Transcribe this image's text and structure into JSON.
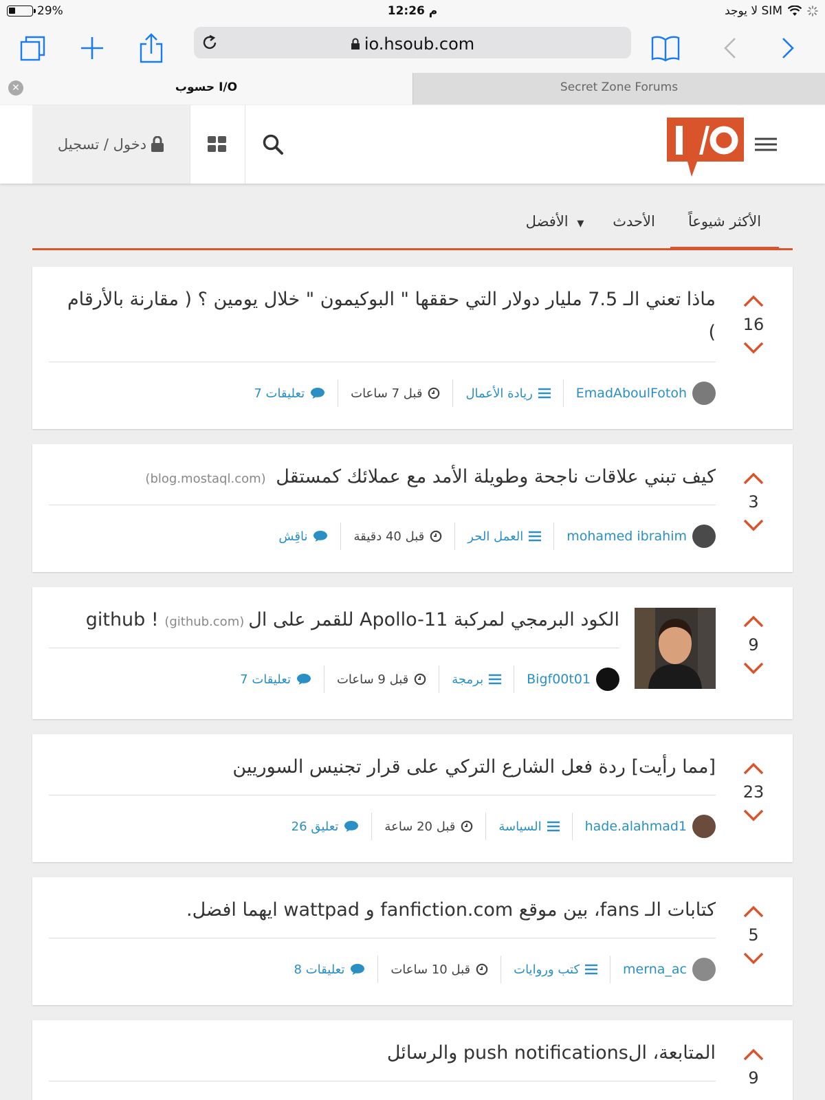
{
  "status": {
    "battery": "29%",
    "time": "12:26 م",
    "carrier": "لا يوجد SIM"
  },
  "browser": {
    "url": "io.hsoub.com"
  },
  "tabs": [
    {
      "title": "حسوب I/O",
      "active": true
    },
    {
      "title": "Secret Zone Forums",
      "active": false
    }
  ],
  "header": {
    "login_label": "دخول / تسجيل",
    "accent": "#d9532b"
  },
  "sort": {
    "popular": "الأكثر شيوعاً",
    "newest": "الأحدث",
    "best": "الأفضل"
  },
  "posts": [
    {
      "votes": "16",
      "title": "ماذا تعني الـ 7.5 مليار دولار التي حققها \" البوكيمون \" خلال يومين ؟ ( مقارنة بالأرقام )",
      "domain": "",
      "author": "EmadAboulFotoh",
      "category": "ريادة الأعمال",
      "time": "قبل 7 ساعات",
      "comments": "7 تعليقات"
    },
    {
      "votes": "3",
      "title": "كيف تبني علاقات ناجحة وطويلة الأمد مع عملائك كمستقل",
      "domain": "(blog.mostaql.com)",
      "author": "mohamed ibrahim",
      "category": "العمل الحر",
      "time": "قبل 40 دقيقة",
      "comments": "ناقِش"
    },
    {
      "votes": "9",
      "title": "الكود البرمجي لمركبة Apollo-11 للقمر على الgithub !",
      "domain": "(github.com)",
      "author": "Bigf00t01",
      "category": "برمجة",
      "time": "قبل 9 ساعات",
      "comments": "7 تعليقات"
    },
    {
      "votes": "23",
      "title": "[مما رأيت] ردة فعل الشارع التركي على قرار تجنيس السوريين",
      "domain": "",
      "author": "hade.alahmad1",
      "category": "السياسة",
      "time": "قبل 20 ساعة",
      "comments": "26 تعليق"
    },
    {
      "votes": "5",
      "title": "كتابات الـ fans، بين موقع fanfiction.com و wattpad ايهما افضل.",
      "domain": "",
      "author": "merna_ac",
      "category": "كتب وروايات",
      "time": "قبل 10 ساعات",
      "comments": "8 تعليقات"
    },
    {
      "votes": "9",
      "title": "المتابعة، الpush notifications والرسائل",
      "domain": "",
      "author": "",
      "category": "",
      "time": "",
      "comments": ""
    }
  ]
}
